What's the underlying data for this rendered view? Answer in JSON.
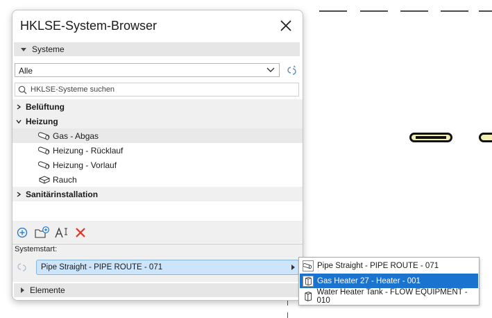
{
  "window": {
    "title": "HKLSE-System-Browser"
  },
  "systeme_section": {
    "label": "Systeme",
    "filter_value": "Alle",
    "search_placeholder": "HKLSE-Systeme suchen"
  },
  "tree": {
    "groups": [
      {
        "label": "Belüftung",
        "expanded": false
      },
      {
        "label": "Heizung",
        "expanded": true,
        "children": [
          {
            "label": "Gas - Abgas",
            "icon": "pipe-icon",
            "selected": true
          },
          {
            "label": "Heizung - Rücklauf",
            "icon": "pipe-icon"
          },
          {
            "label": "Heizung - Vorlauf",
            "icon": "pipe-icon"
          },
          {
            "label": "Rauch",
            "icon": "duct-box-icon"
          }
        ]
      },
      {
        "label": "Sanitärinstallation",
        "expanded": false
      }
    ]
  },
  "toolbar": {
    "tools": [
      "add-system-icon",
      "new-folder-icon",
      "rename-icon",
      "delete-icon"
    ]
  },
  "systemstart": {
    "label": "Systemstart:",
    "value": "Pipe Straight - PIPE ROUTE - 071"
  },
  "elemente_section": {
    "label": "Elemente"
  },
  "popup": {
    "items": [
      {
        "label": "Pipe Straight - PIPE ROUTE - 071",
        "icon": "pipe-icon",
        "highlighted": false
      },
      {
        "label": "Gas Heater 27 - Heater - 001",
        "icon": "equipment-icon",
        "highlighted": true
      },
      {
        "label": "Water Heater Tank - FLOW EQUIPMENT - 010",
        "icon": "equipment-icon",
        "highlighted": false
      }
    ]
  },
  "colors": {
    "highlight": "#1a73cf",
    "systemstart_field": "#cde5fa",
    "delete": "#e53222",
    "add": "#1a73cf"
  }
}
